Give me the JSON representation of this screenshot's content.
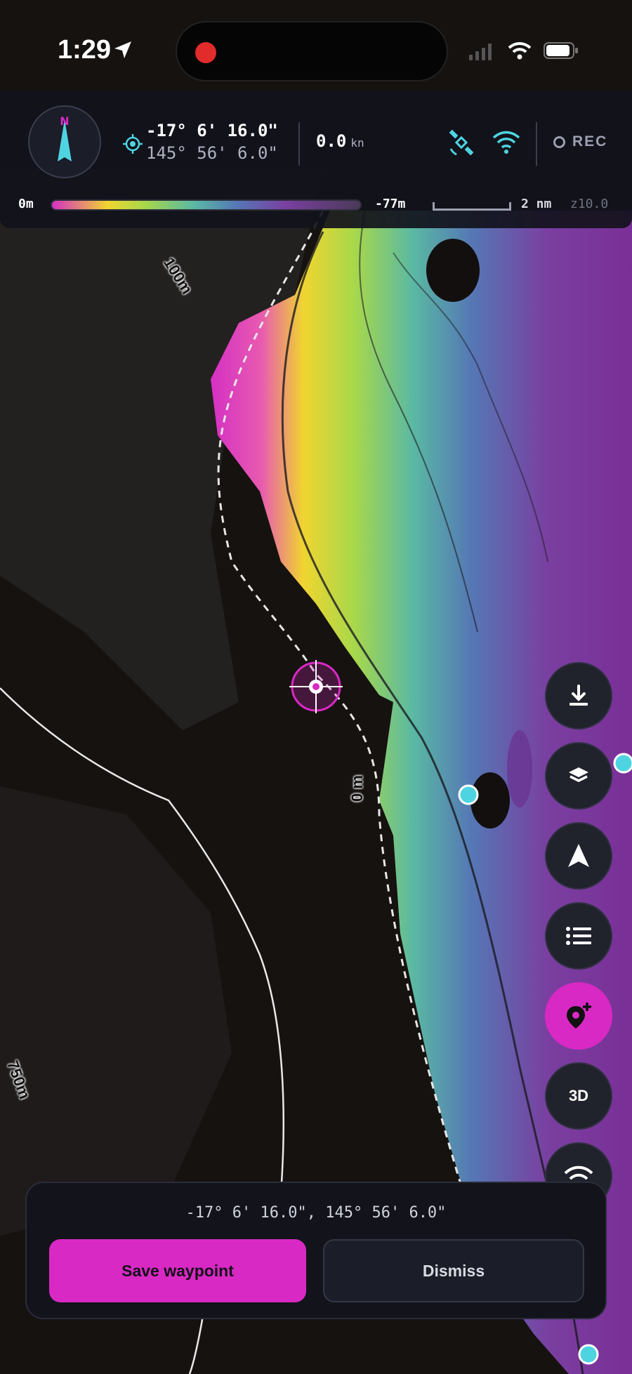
{
  "status_bar": {
    "time": "1:29"
  },
  "hud": {
    "compass_label": "N",
    "latitude": "-17° 6' 16.0\"",
    "longitude": "145° 56' 6.0\"",
    "speed": "0.0",
    "speed_unit": "kn",
    "rec_label": "REC",
    "depth_min": "0m",
    "depth_max": "-77m",
    "scale_label": "2 nm",
    "zoom_label": "z10.0"
  },
  "map": {
    "contour_labels": [
      "100m",
      "0 m",
      "750m"
    ]
  },
  "toolbar": {
    "buttons": [
      "download-icon",
      "layers-icon",
      "navigate-icon",
      "list-icon",
      "add-waypoint-icon",
      "3D",
      "wifi-icon"
    ],
    "three_d_label": "3D"
  },
  "sheet": {
    "coordinates": "-17° 6' 16.0\", 145° 56' 6.0\"",
    "save_label": "Save waypoint",
    "dismiss_label": "Dismiss"
  },
  "colors": {
    "accent": "#d929c4",
    "gps_cyan": "#4ed4e0",
    "land": "#161210"
  }
}
